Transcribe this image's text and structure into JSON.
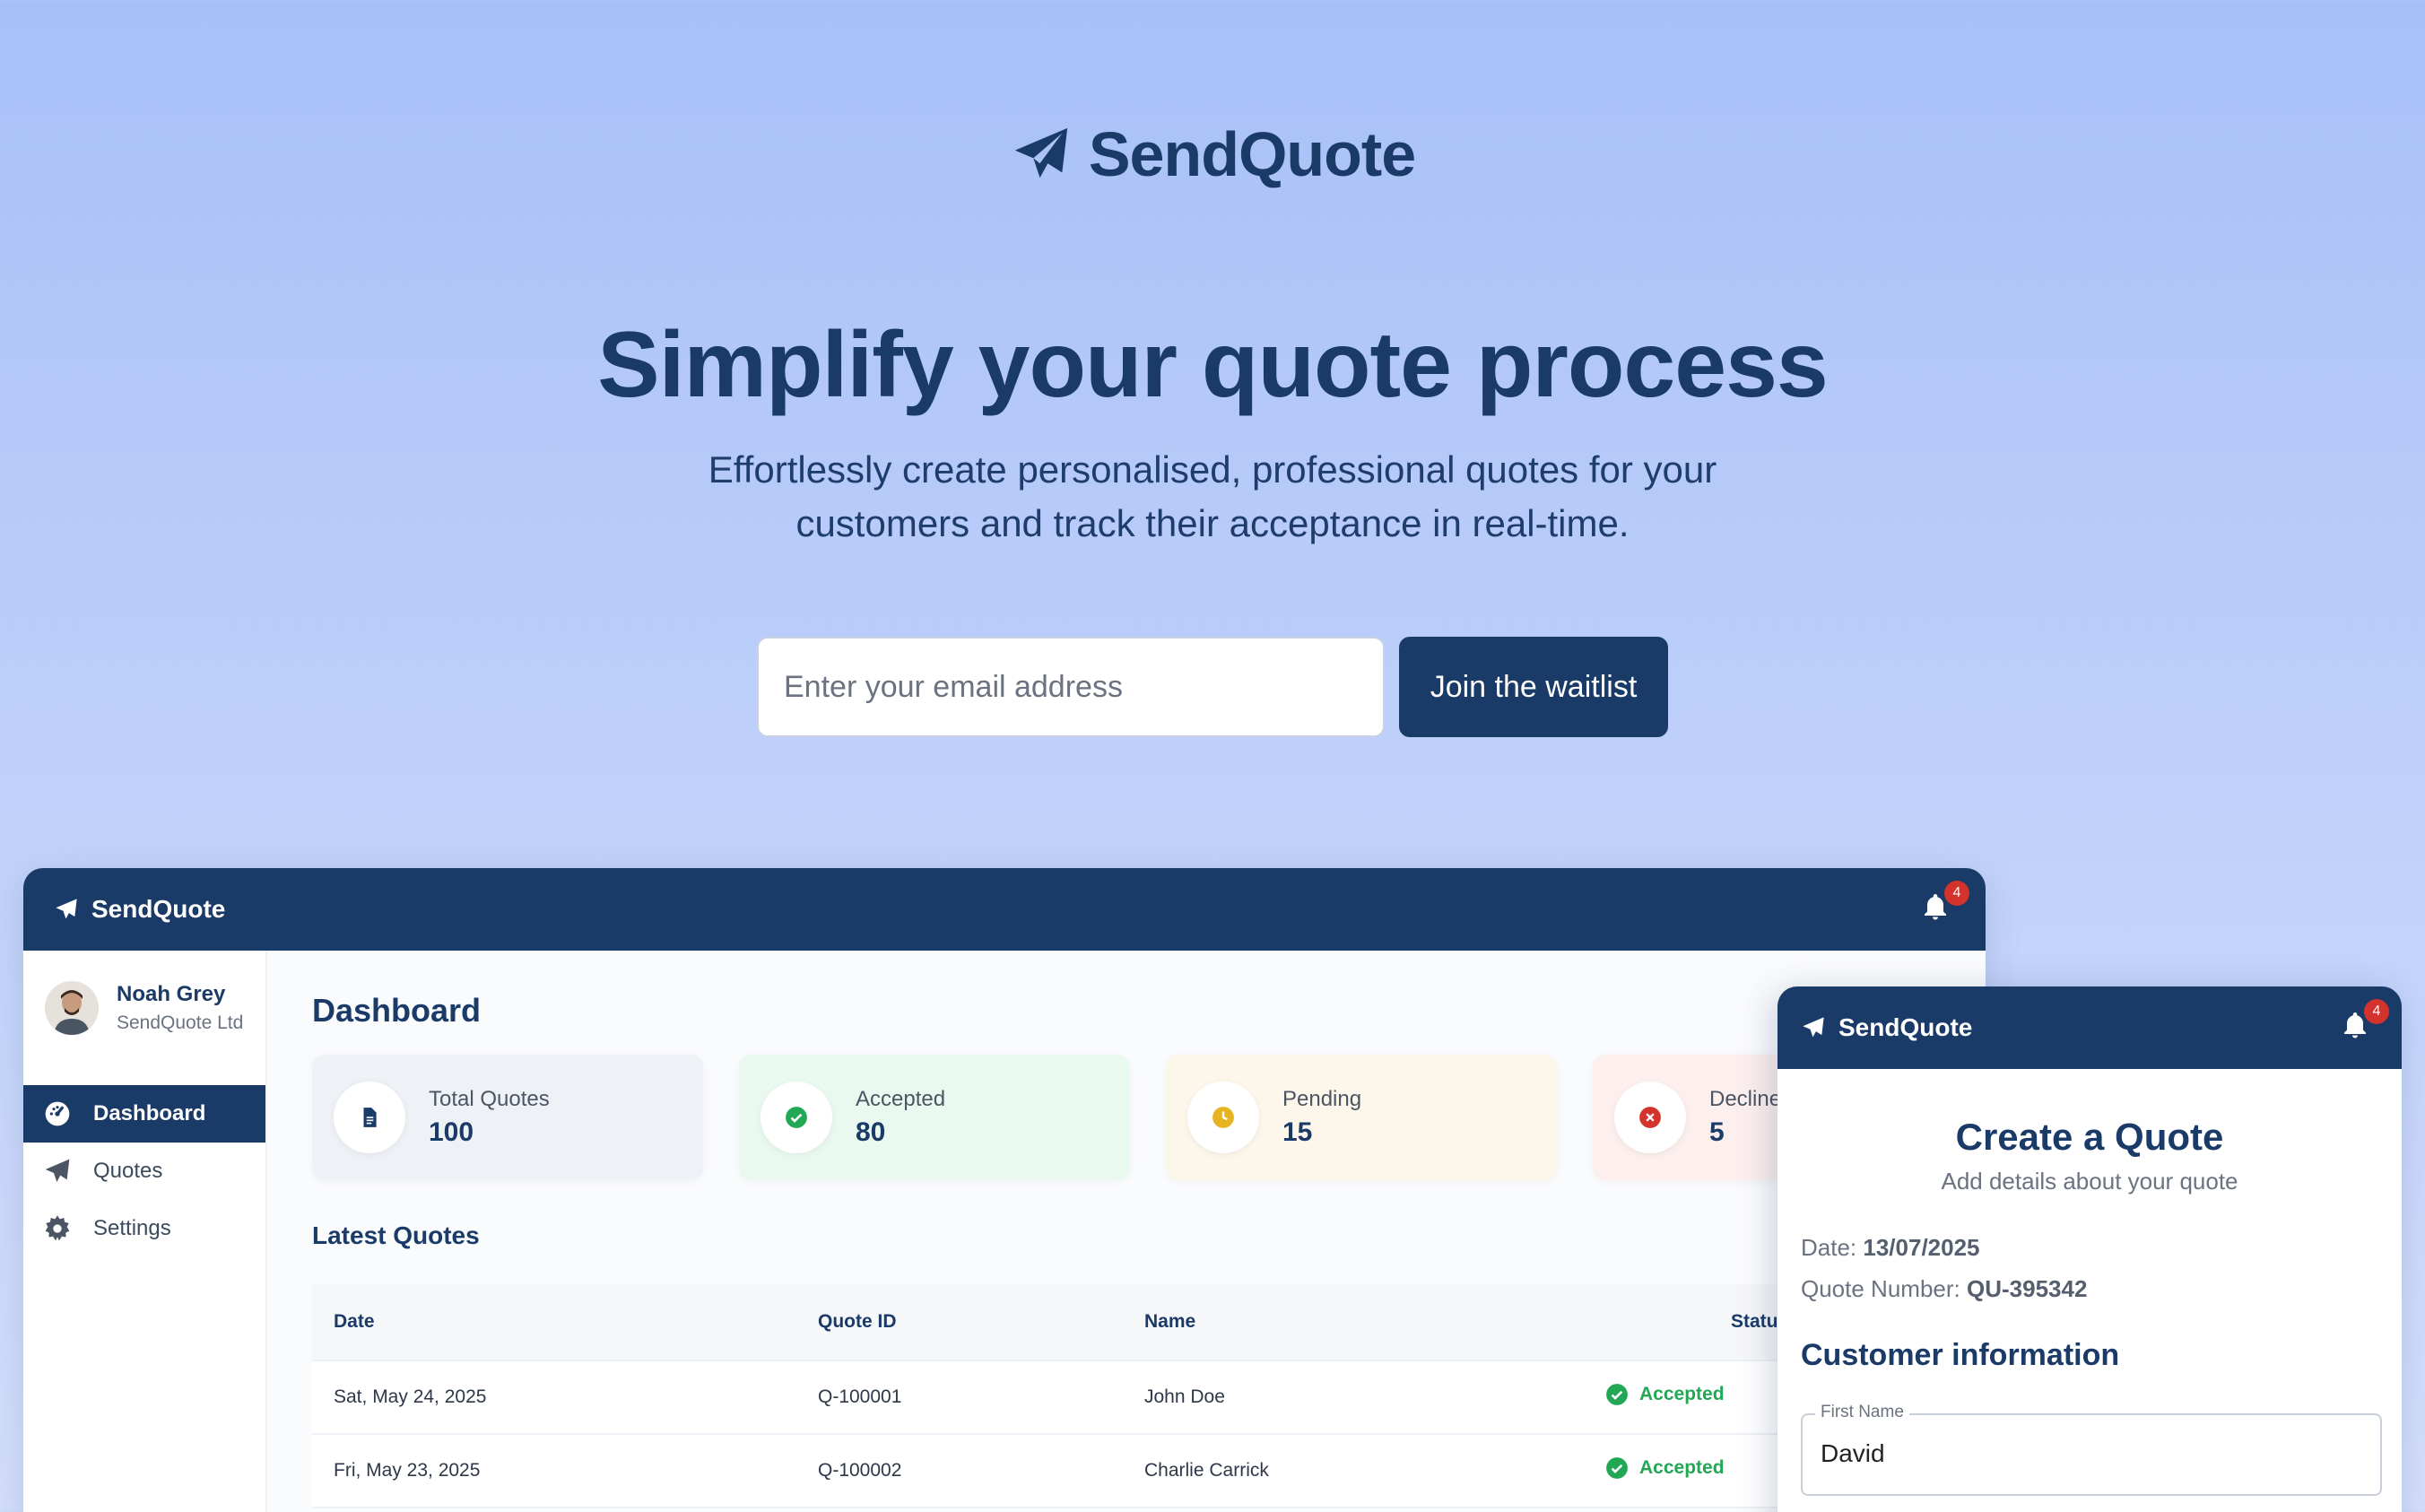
{
  "brand": {
    "name": "SendQuote",
    "icon": "paper-plane-icon"
  },
  "hero": {
    "title": "Simplify your quote process",
    "subtitle": "Effortlessly create personalised, professional quotes for your customers and track their acceptance in real-time."
  },
  "signup": {
    "email_placeholder": "Enter your email address",
    "email_value": "",
    "button_label": "Join the waitlist"
  },
  "dashboard": {
    "app_name": "SendQuote",
    "notifications_count": "4",
    "user": {
      "name": "Noah Grey",
      "company": "SendQuote Ltd"
    },
    "nav": [
      {
        "label": "Dashboard",
        "icon": "gauge-icon",
        "active": true
      },
      {
        "label": "Quotes",
        "icon": "paper-plane-icon",
        "active": false
      },
      {
        "label": "Settings",
        "icon": "gear-icon",
        "active": false
      }
    ],
    "title": "Dashboard",
    "stats": [
      {
        "label": "Total Quotes",
        "value": "100",
        "icon": "document-icon",
        "bg": "#eef1f5",
        "color": "#1a3a68"
      },
      {
        "label": "Accepted",
        "value": "80",
        "icon": "check-circle-icon",
        "bg": "#eaf9ef",
        "color": "#22a855"
      },
      {
        "label": "Pending",
        "value": "15",
        "icon": "clock-icon",
        "bg": "#fdf6ea",
        "color": "#e6b321"
      },
      {
        "label": "Declined",
        "value": "5",
        "icon": "x-circle-icon",
        "bg": "#fcefee",
        "color": "#d3322d"
      }
    ],
    "latest_title": "Latest Quotes",
    "table": {
      "headers": [
        "Date",
        "Quote ID",
        "Name",
        "Statu"
      ],
      "rows": [
        {
          "date": "Sat, May 24, 2025",
          "id": "Q-100001",
          "name": "John Doe",
          "status": "Accepted"
        },
        {
          "date": "Fri, May 23, 2025",
          "id": "Q-100002",
          "name": "Charlie Carrick",
          "status": "Accepted"
        }
      ]
    }
  },
  "quote_card": {
    "app_name": "SendQuote",
    "notifications_count": "4",
    "title": "Create a Quote",
    "subtitle": "Add details about your quote",
    "date_label": "Date:",
    "date_value": "13/07/2025",
    "number_label": "Quote Number:",
    "number_value": "QU-395342",
    "section_title": "Customer information",
    "first_name_label": "First Name",
    "first_name_value": "David"
  },
  "colors": {
    "navy": "#1a3a68",
    "accepted": "#22a855",
    "badge": "#d3322d"
  }
}
